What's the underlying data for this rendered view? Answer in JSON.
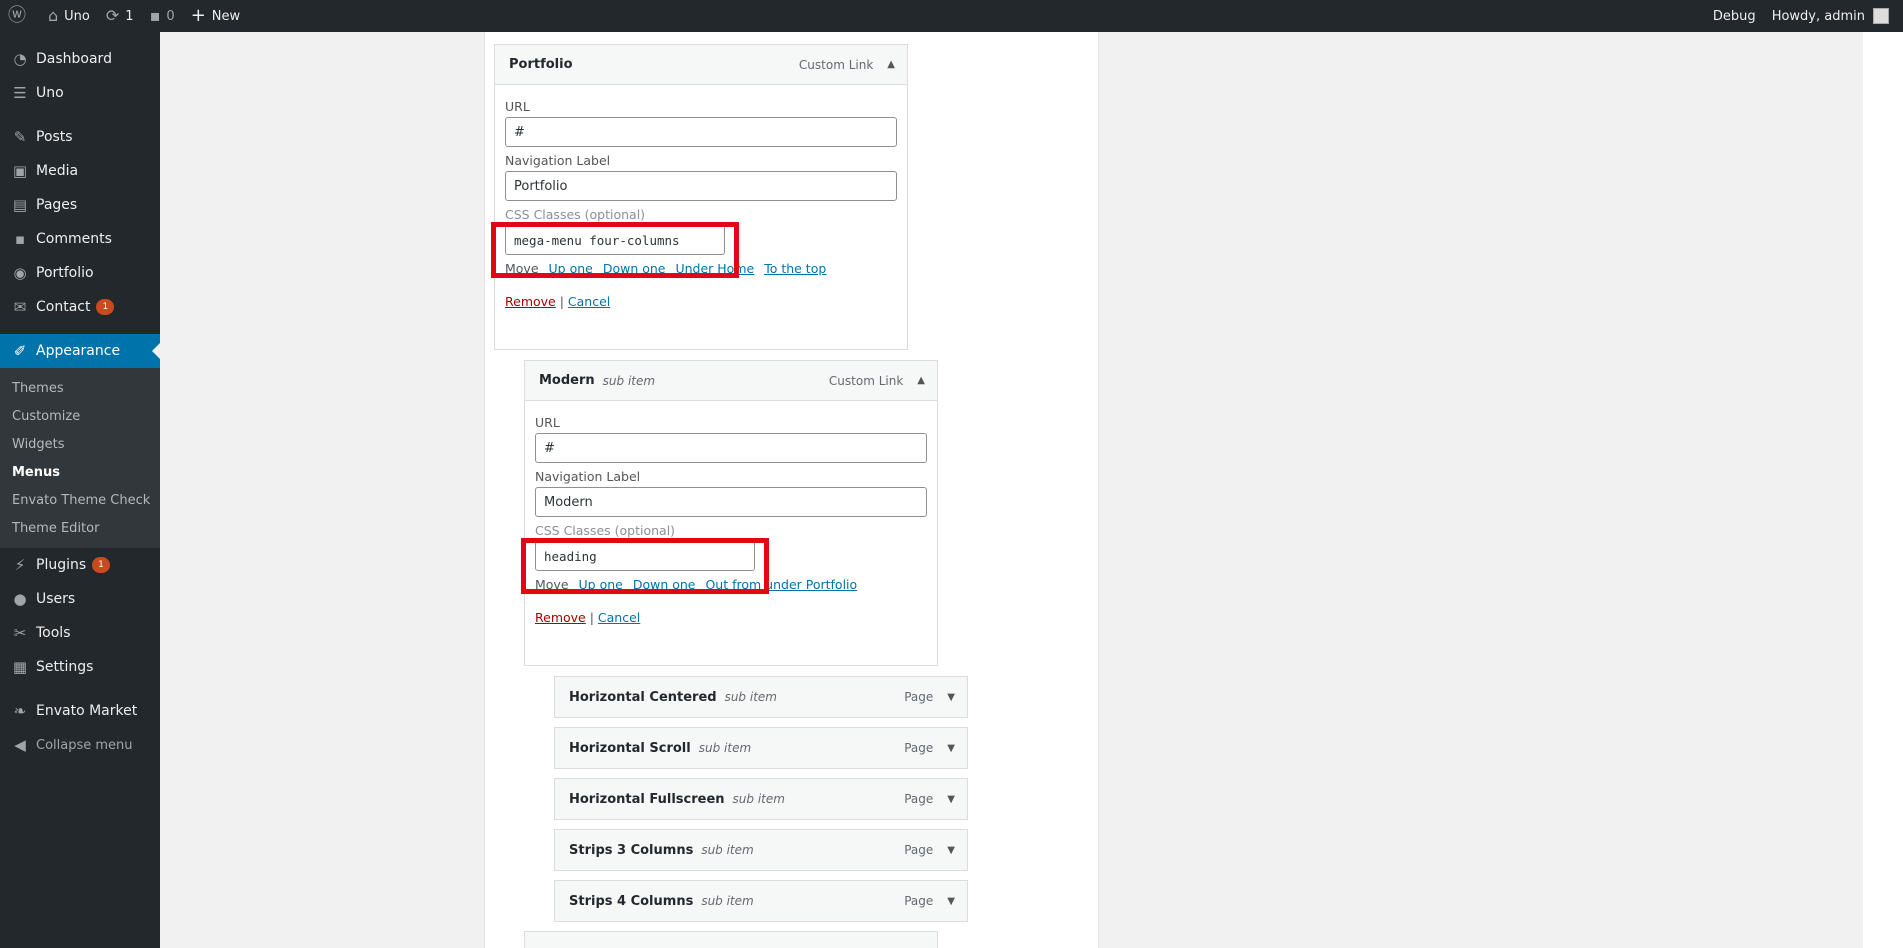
{
  "adminbar": {
    "site_name": "Uno",
    "updates_count": "1",
    "comments_count": "0",
    "new_label": "New",
    "debug_label": "Debug",
    "howdy": "Howdy, admin"
  },
  "sidebar": {
    "items": [
      {
        "label": "Dashboard",
        "icon": "dashboard-icon"
      },
      {
        "label": "Uno",
        "icon": "uno-icon"
      },
      {
        "label": "Posts",
        "icon": "pin-icon"
      },
      {
        "label": "Media",
        "icon": "media-icon"
      },
      {
        "label": "Pages",
        "icon": "pages-icon"
      },
      {
        "label": "Comments",
        "icon": "comments-icon"
      },
      {
        "label": "Portfolio",
        "icon": "portfolio-icon"
      },
      {
        "label": "Contact",
        "icon": "mail-icon",
        "badge": "1"
      },
      {
        "label": "Appearance",
        "icon": "brush-icon"
      },
      {
        "label": "Plugins",
        "icon": "plugins-icon",
        "badge": "1"
      },
      {
        "label": "Users",
        "icon": "users-icon"
      },
      {
        "label": "Tools",
        "icon": "tools-icon"
      },
      {
        "label": "Settings",
        "icon": "settings-icon"
      },
      {
        "label": "Envato Market",
        "icon": "leaf-icon"
      },
      {
        "label": "Collapse menu",
        "icon": "collapse-icon"
      }
    ],
    "submenu": [
      "Themes",
      "Customize",
      "Widgets",
      "Menus",
      "Envato Theme Check",
      "Theme Editor"
    ]
  },
  "menu_items": {
    "portfolio": {
      "title": "Portfolio",
      "type": "Custom Link",
      "url_label": "URL",
      "url_value": "#",
      "nav_label": "Navigation Label",
      "nav_value": "Portfolio",
      "css_label": "CSS Classes (optional)",
      "css_value": "mega-menu four-columns",
      "move_label": "Move",
      "move_links": [
        "Up one",
        "Down one",
        "Under Home",
        "To the top"
      ],
      "remove": "Remove",
      "sep": "|",
      "cancel": "Cancel"
    },
    "modern": {
      "title": "Modern",
      "sub": "sub item",
      "type": "Custom Link",
      "url_label": "URL",
      "url_value": "#",
      "nav_label": "Navigation Label",
      "nav_value": "Modern",
      "css_label": "CSS Classes (optional)",
      "css_value": "heading",
      "move_label": "Move",
      "move_links": [
        "Up one",
        "Down one",
        "Out from under Portfolio"
      ],
      "remove": "Remove",
      "sep": "|",
      "cancel": "Cancel"
    },
    "collapsed": [
      {
        "title": "Horizontal Centered",
        "sub": "sub item",
        "type": "Page"
      },
      {
        "title": "Horizontal Scroll",
        "sub": "sub item",
        "type": "Page"
      },
      {
        "title": "Horizontal Fullscreen",
        "sub": "sub item",
        "type": "Page"
      },
      {
        "title": "Strips 3 Columns",
        "sub": "sub item",
        "type": "Page"
      },
      {
        "title": "Strips 4 Columns",
        "sub": "sub item",
        "type": "Page"
      }
    ]
  },
  "colors": {
    "admin_dark": "#23282d",
    "accent": "#0073aa",
    "highlight": "#e30613",
    "badge": "#ca4a1f"
  }
}
